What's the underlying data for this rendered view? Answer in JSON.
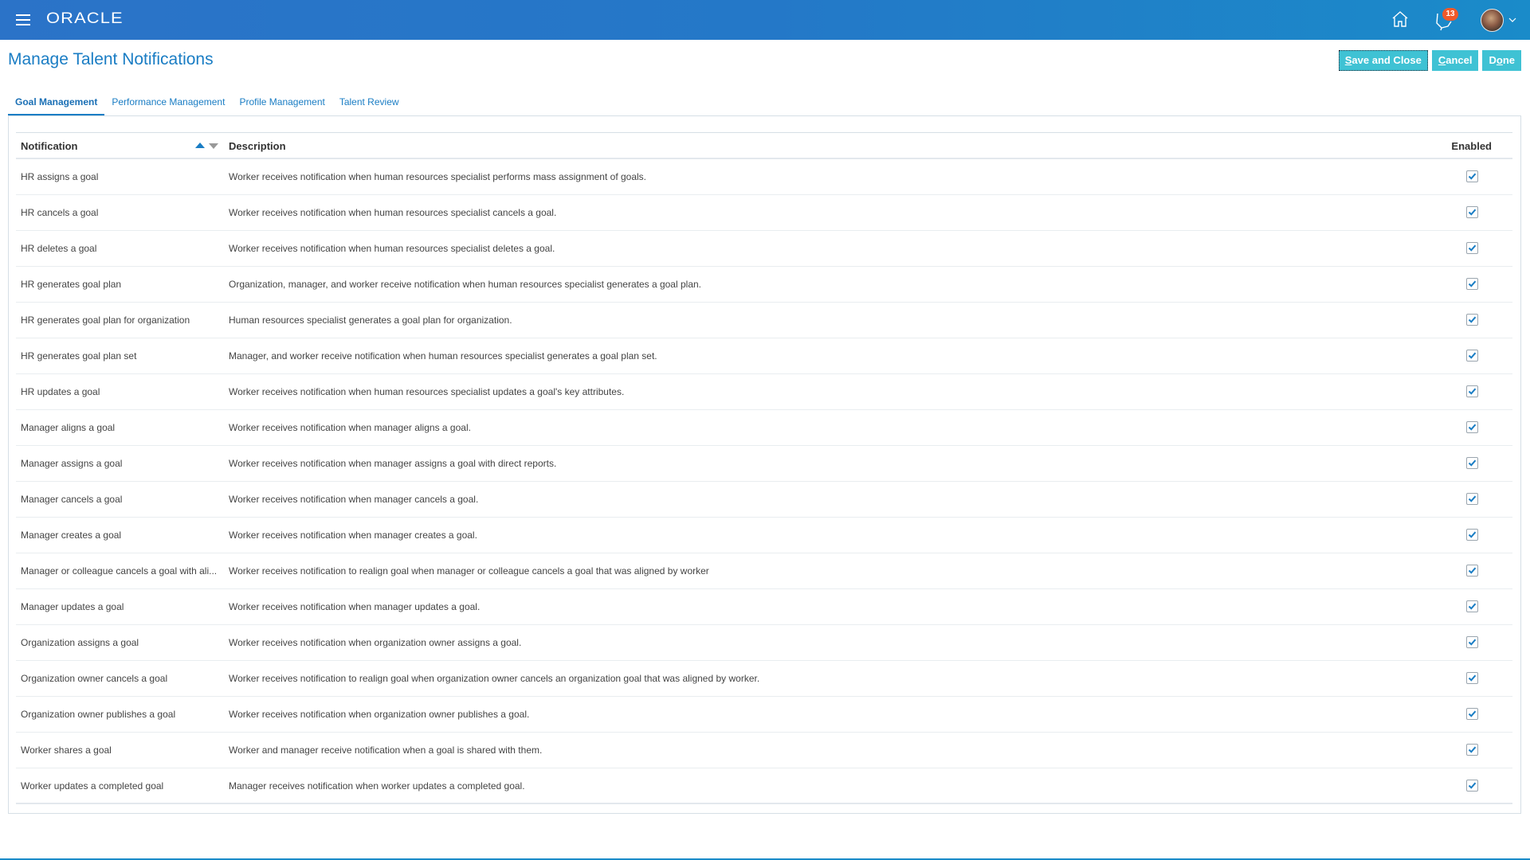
{
  "header": {
    "brand": "ORACLE",
    "notification_count": "13",
    "icons": [
      "hamburger-menu-icon",
      "home-icon",
      "notifications-icon",
      "user-avatar",
      "chevron-down-icon"
    ]
  },
  "page": {
    "title": "Manage Talent Notifications"
  },
  "actions": {
    "save_close": {
      "pre": "",
      "u": "S",
      "post": "ave and Close"
    },
    "cancel": {
      "pre": "",
      "u": "C",
      "post": "ancel"
    },
    "done": {
      "pre": "D",
      "u": "o",
      "post": "ne"
    }
  },
  "tabs": [
    {
      "label": "Goal Management",
      "active": true
    },
    {
      "label": "Performance Management",
      "active": false
    },
    {
      "label": "Profile Management",
      "active": false
    },
    {
      "label": "Talent Review",
      "active": false
    }
  ],
  "table": {
    "columns": {
      "notification": "Notification",
      "description": "Description",
      "enabled": "Enabled"
    },
    "sort": {
      "column": "notification",
      "direction": "ascending"
    },
    "rows": [
      {
        "notification": "HR assigns a goal",
        "description": "Worker receives notification when human resources specialist performs mass assignment of goals.",
        "enabled": true
      },
      {
        "notification": "HR cancels a goal",
        "description": "Worker receives notification when human resources specialist cancels a goal.",
        "enabled": true
      },
      {
        "notification": "HR deletes a goal",
        "description": "Worker receives notification when human resources specialist deletes a goal.",
        "enabled": true
      },
      {
        "notification": "HR generates goal plan",
        "description": "Organization, manager, and worker receive notification when human resources specialist generates a goal plan.",
        "enabled": true
      },
      {
        "notification": "HR generates goal plan for organization",
        "description": "Human resources specialist generates a goal plan for organization.",
        "enabled": true
      },
      {
        "notification": "HR generates goal plan set",
        "description": "Manager, and worker receive notification when human resources specialist generates a goal plan set.",
        "enabled": true
      },
      {
        "notification": "HR updates a goal",
        "description": "Worker receives notification when human resources specialist updates a goal's key attributes.",
        "enabled": true
      },
      {
        "notification": "Manager aligns a goal",
        "description": "Worker receives notification when manager aligns a goal.",
        "enabled": true
      },
      {
        "notification": "Manager assigns a goal",
        "description": "Worker receives notification when manager assigns a goal with direct reports.",
        "enabled": true
      },
      {
        "notification": "Manager cancels a goal",
        "description": "Worker receives notification when manager cancels a goal.",
        "enabled": true
      },
      {
        "notification": "Manager creates a goal",
        "description": "Worker receives notification when manager creates a goal.",
        "enabled": true
      },
      {
        "notification": "Manager or colleague cancels a goal with ali...",
        "description": "Worker receives notification to realign goal when manager or colleague cancels a goal that was aligned by worker",
        "enabled": true
      },
      {
        "notification": "Manager updates a goal",
        "description": "Worker receives notification when manager updates a goal.",
        "enabled": true
      },
      {
        "notification": "Organization assigns a goal",
        "description": "Worker receives notification when organization owner assigns a goal.",
        "enabled": true
      },
      {
        "notification": "Organization owner cancels a goal",
        "description": "Worker receives notification to realign goal when organization owner cancels an organization goal that was aligned by worker.",
        "enabled": true
      },
      {
        "notification": "Organization owner publishes a goal",
        "description": "Worker receives notification when organization owner publishes a goal.",
        "enabled": true
      },
      {
        "notification": "Worker shares a goal",
        "description": "Worker and manager receive notification when a goal is shared with them.",
        "enabled": true
      },
      {
        "notification": "Worker updates a completed goal",
        "description": "Manager receives notification when worker updates a completed goal.",
        "enabled": true
      }
    ]
  },
  "colors": {
    "header_blue": "#2478c8",
    "accent_blue": "#1a7dc4",
    "button_teal": "#3fc2d4",
    "badge_orange": "#f0592a"
  }
}
